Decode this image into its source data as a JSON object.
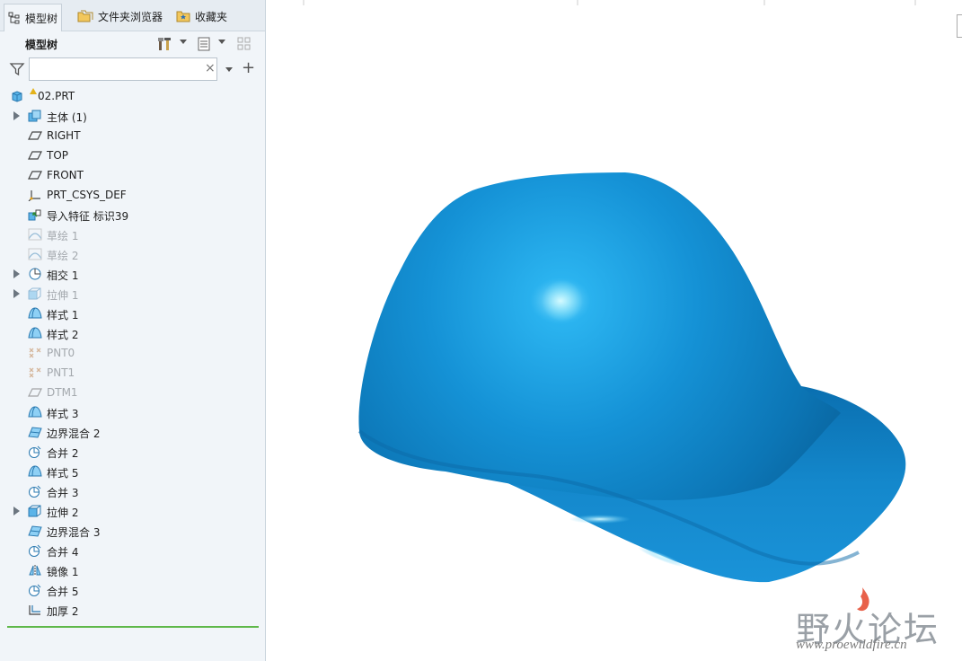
{
  "tabs": [
    {
      "label": "模型树",
      "icon": "model-tree-icon",
      "active": true
    },
    {
      "label": "文件夹浏览器",
      "icon": "folder-browser-icon",
      "active": false
    },
    {
      "label": "收藏夹",
      "icon": "favorites-icon",
      "active": false
    }
  ],
  "tree_panel": {
    "title": "模型树",
    "search": {
      "value": "",
      "placeholder": ""
    },
    "clear_symbol": "×",
    "add_symbol": "+"
  },
  "tree": {
    "root": {
      "label": "02.PRT",
      "icon": "part-icon"
    },
    "items": [
      {
        "label": "主体 (1)",
        "icon": "body-icon",
        "expandable": true,
        "dim": false
      },
      {
        "label": "RIGHT",
        "icon": "datum-plane-icon",
        "expandable": false,
        "dim": false
      },
      {
        "label": "TOP",
        "icon": "datum-plane-icon",
        "expandable": false,
        "dim": false
      },
      {
        "label": "FRONT",
        "icon": "datum-plane-icon",
        "expandable": false,
        "dim": false
      },
      {
        "label": "PRT_CSYS_DEF",
        "icon": "coordinate-system-icon",
        "expandable": false,
        "dim": false
      },
      {
        "label": "导入特征 标识39",
        "icon": "import-feature-icon",
        "expandable": false,
        "dim": false
      },
      {
        "label": "草绘 1",
        "icon": "sketch-icon",
        "expandable": false,
        "dim": true
      },
      {
        "label": "草绘 2",
        "icon": "sketch-icon",
        "expandable": false,
        "dim": true
      },
      {
        "label": "相交 1",
        "icon": "intersect-icon",
        "expandable": true,
        "dim": false
      },
      {
        "label": "拉伸 1",
        "icon": "extrude-icon",
        "expandable": true,
        "dim": true
      },
      {
        "label": "样式 1",
        "icon": "style-surface-icon",
        "expandable": false,
        "dim": false
      },
      {
        "label": "样式 2",
        "icon": "style-surface-icon",
        "expandable": false,
        "dim": false
      },
      {
        "label": "PNT0",
        "icon": "datum-point-icon",
        "expandable": false,
        "dim": true
      },
      {
        "label": "PNT1",
        "icon": "datum-point-icon",
        "expandable": false,
        "dim": true
      },
      {
        "label": "DTM1",
        "icon": "datum-plane-icon",
        "expandable": false,
        "dim": true
      },
      {
        "label": "样式 3",
        "icon": "style-surface-icon",
        "expandable": false,
        "dim": false
      },
      {
        "label": "边界混合 2",
        "icon": "boundary-blend-icon",
        "expandable": false,
        "dim": false
      },
      {
        "label": "合并 2",
        "icon": "merge-icon",
        "expandable": false,
        "dim": false
      },
      {
        "label": "样式 5",
        "icon": "style-surface-icon",
        "expandable": false,
        "dim": false
      },
      {
        "label": "合并 3",
        "icon": "merge-icon",
        "expandable": false,
        "dim": false
      },
      {
        "label": "拉伸 2",
        "icon": "extrude-icon",
        "expandable": true,
        "dim": false
      },
      {
        "label": "边界混合 3",
        "icon": "boundary-blend-icon",
        "expandable": false,
        "dim": false
      },
      {
        "label": "合并 4",
        "icon": "merge-icon",
        "expandable": false,
        "dim": false
      },
      {
        "label": "镜像 1",
        "icon": "mirror-icon",
        "expandable": false,
        "dim": false
      },
      {
        "label": "合并 5",
        "icon": "merge-icon",
        "expandable": false,
        "dim": false
      },
      {
        "label": "加厚 2",
        "icon": "thicken-icon",
        "expandable": false,
        "dim": false
      }
    ]
  },
  "watermark": {
    "title": "野火论坛",
    "url": "www.proewildfire.cn"
  },
  "colors": {
    "model": "#1a93d8",
    "insert_line": "#5fb84a",
    "panel": "#f1f5f9"
  }
}
